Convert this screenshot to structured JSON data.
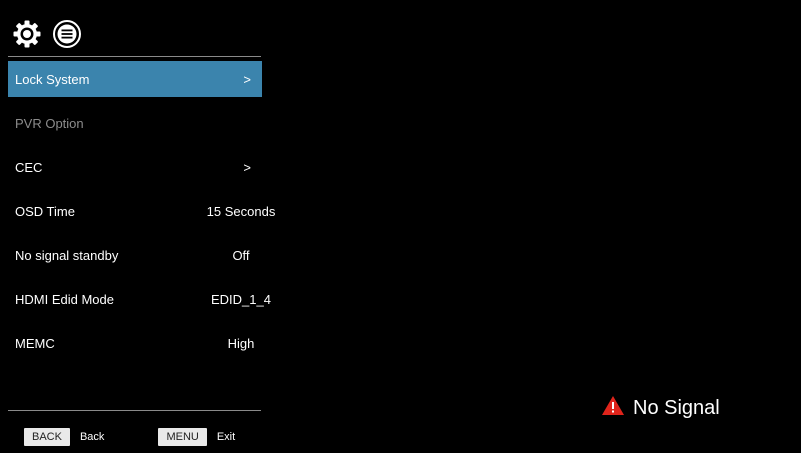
{
  "top_icons": [
    "gear-icon",
    "menu-list-icon"
  ],
  "menu": {
    "items": [
      {
        "label": "Lock System",
        "value": "",
        "arrow": ">"
      },
      {
        "label": "PVR Option",
        "value": "",
        "arrow": ""
      },
      {
        "label": "CEC",
        "value": "",
        "arrow": ">"
      },
      {
        "label": "OSD Time",
        "value": "15 Seconds",
        "arrow": ""
      },
      {
        "label": "No signal standby",
        "value": "Off",
        "arrow": ""
      },
      {
        "label": "HDMI Edid Mode",
        "value": "EDID_1_4",
        "arrow": ""
      },
      {
        "label": "MEMC",
        "value": "High",
        "arrow": ""
      }
    ],
    "selected_index": 0,
    "disabled_index": 1
  },
  "footer": {
    "back_key": "BACK",
    "back_label": "Back",
    "menu_key": "MENU",
    "menu_label": "Exit"
  },
  "status": {
    "icon": "warning-icon",
    "text": "No Signal"
  },
  "colors": {
    "background": "#000000",
    "selected": "#3b84ad",
    "warning": "#e0241b",
    "disabled_text": "#8c8c8c"
  }
}
